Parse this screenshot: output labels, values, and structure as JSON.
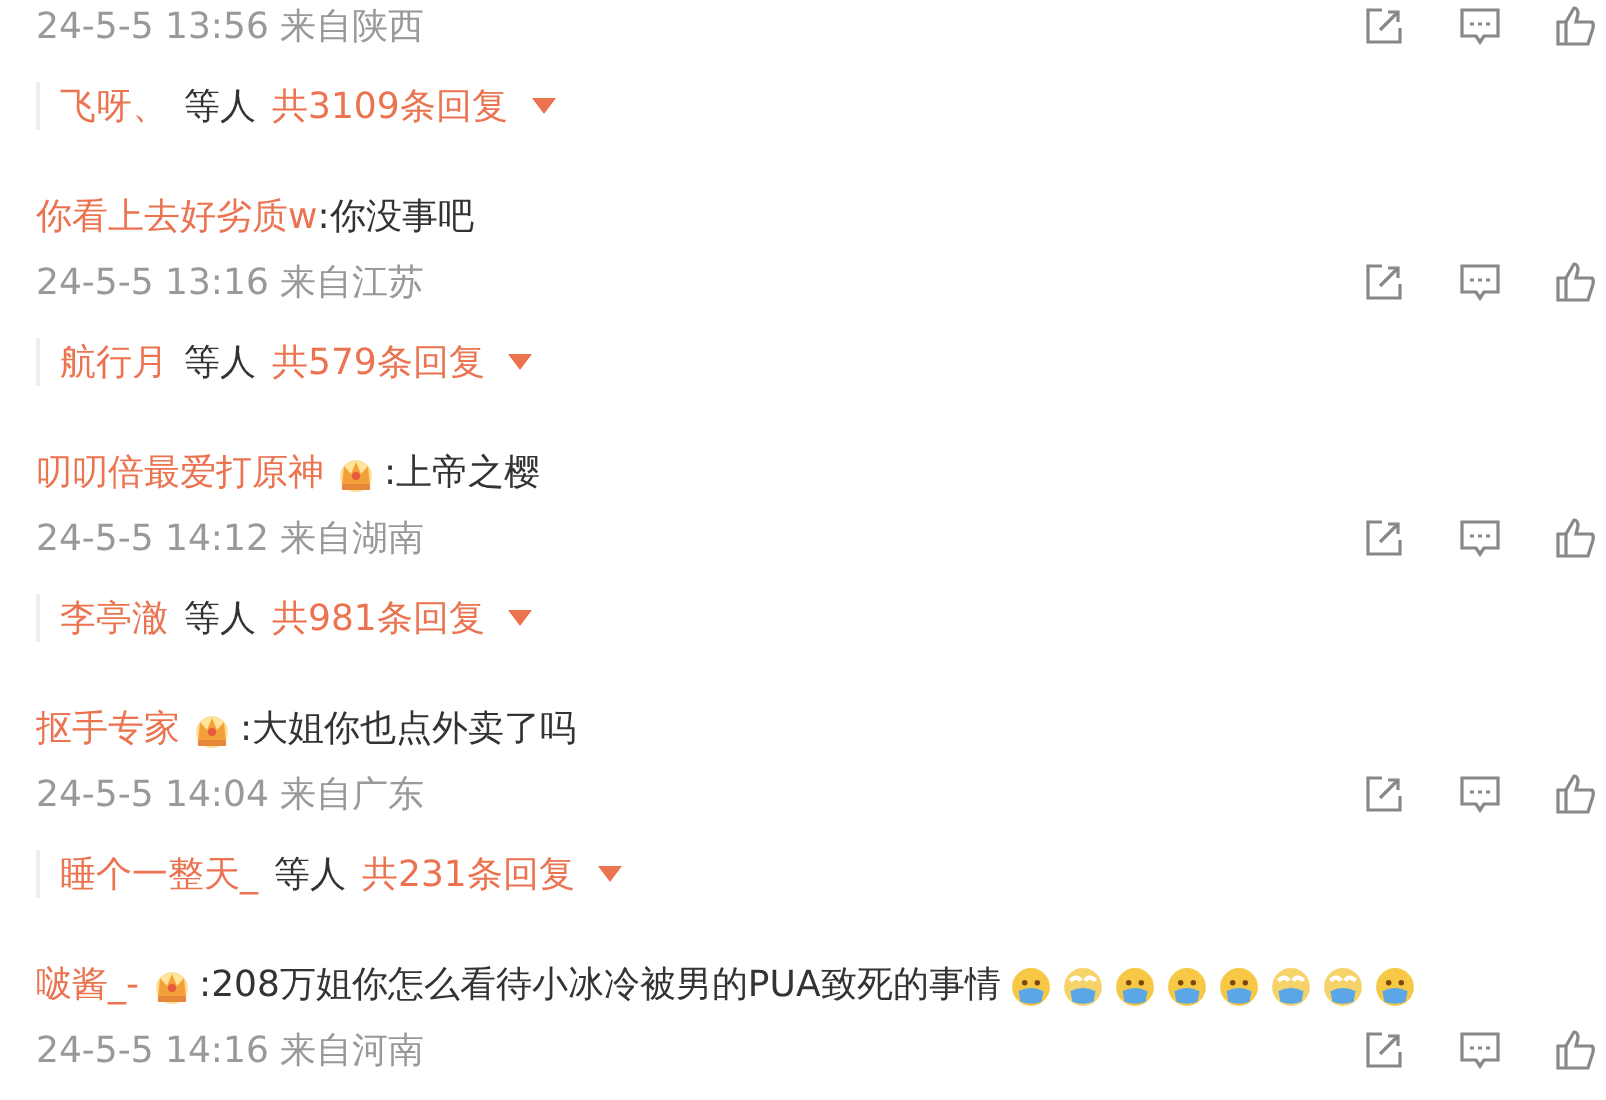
{
  "comments": [
    {
      "meta": "24-5-5 13:56 来自陕西",
      "replies": {
        "names": "飞呀、",
        "suffix": "等人",
        "count": "共3109条回复"
      }
    },
    {
      "author": "你看上去好劣质w",
      "badge": false,
      "text": ":你没事吧",
      "meta": "24-5-5 13:16 来自江苏",
      "replies": {
        "names": "航行月",
        "suffix": "等人",
        "count": "共579条回复"
      }
    },
    {
      "author": "叨叨倍最爱打原神",
      "badge": true,
      "text": ":上帝之樱",
      "meta": "24-5-5 14:12 来自湖南",
      "replies": {
        "names": "李亭澈",
        "suffix": "等人",
        "count": "共981条回复"
      }
    },
    {
      "author": "抠手专家",
      "badge": true,
      "text": ":大姐你也点外卖了吗",
      "meta": "24-5-5 14:04 来自广东",
      "replies": {
        "names": "睡个一整天_",
        "suffix": "等人",
        "count": "共231条回复"
      }
    },
    {
      "author": "啵酱_-",
      "badge": true,
      "text": ":208万姐你怎么看待小冰冷被男的PUA致死的事情",
      "emojis": [
        {
          "kind": "mask"
        },
        {
          "kind": "cry"
        },
        {
          "kind": "mask"
        },
        {
          "kind": "mask"
        },
        {
          "kind": "mask"
        },
        {
          "kind": "cry"
        },
        {
          "kind": "cry"
        },
        {
          "kind": "mask"
        }
      ],
      "meta": "24-5-5 14:16 来自河南"
    }
  ]
}
